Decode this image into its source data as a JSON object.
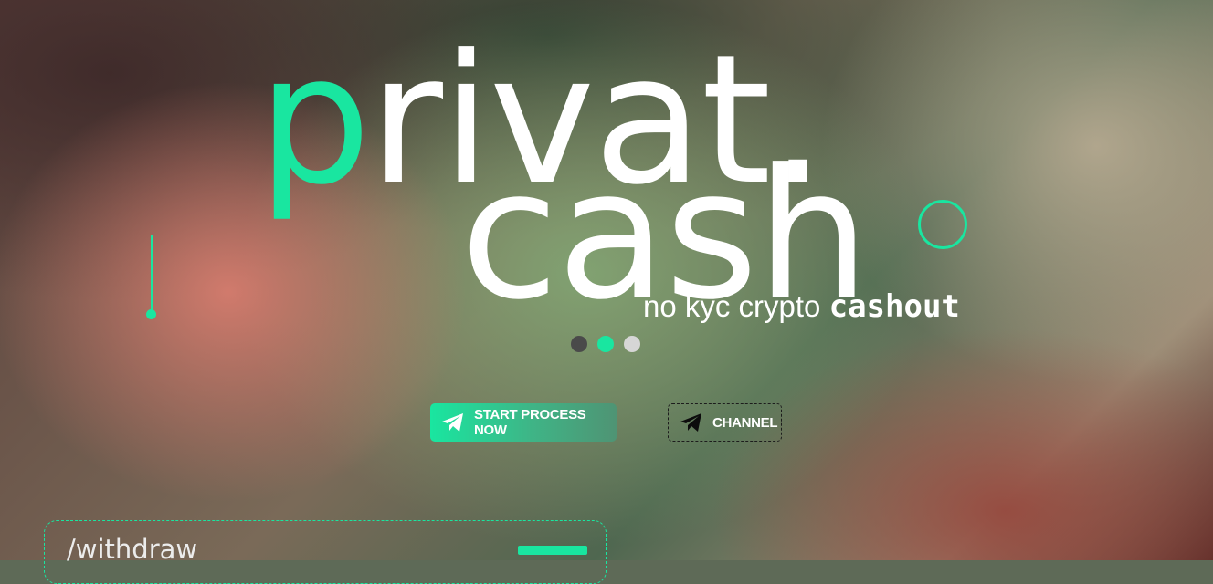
{
  "brand": {
    "logo_accent_letter": "p",
    "logo_line1_rest": "rivat.",
    "logo_line2": "cash",
    "tagline_light": "no kyc crypto",
    "tagline_bold": "cashout",
    "accent_color": "#19e6a0"
  },
  "carousel": {
    "dots": 3,
    "active_index": 1
  },
  "actions": {
    "start_label": "START PROCESS NOW",
    "start_icon": "telegram-icon",
    "channel_label": "CHANNEL",
    "channel_icon": "telegram-icon"
  },
  "withdraw": {
    "label": "/withdraw"
  }
}
